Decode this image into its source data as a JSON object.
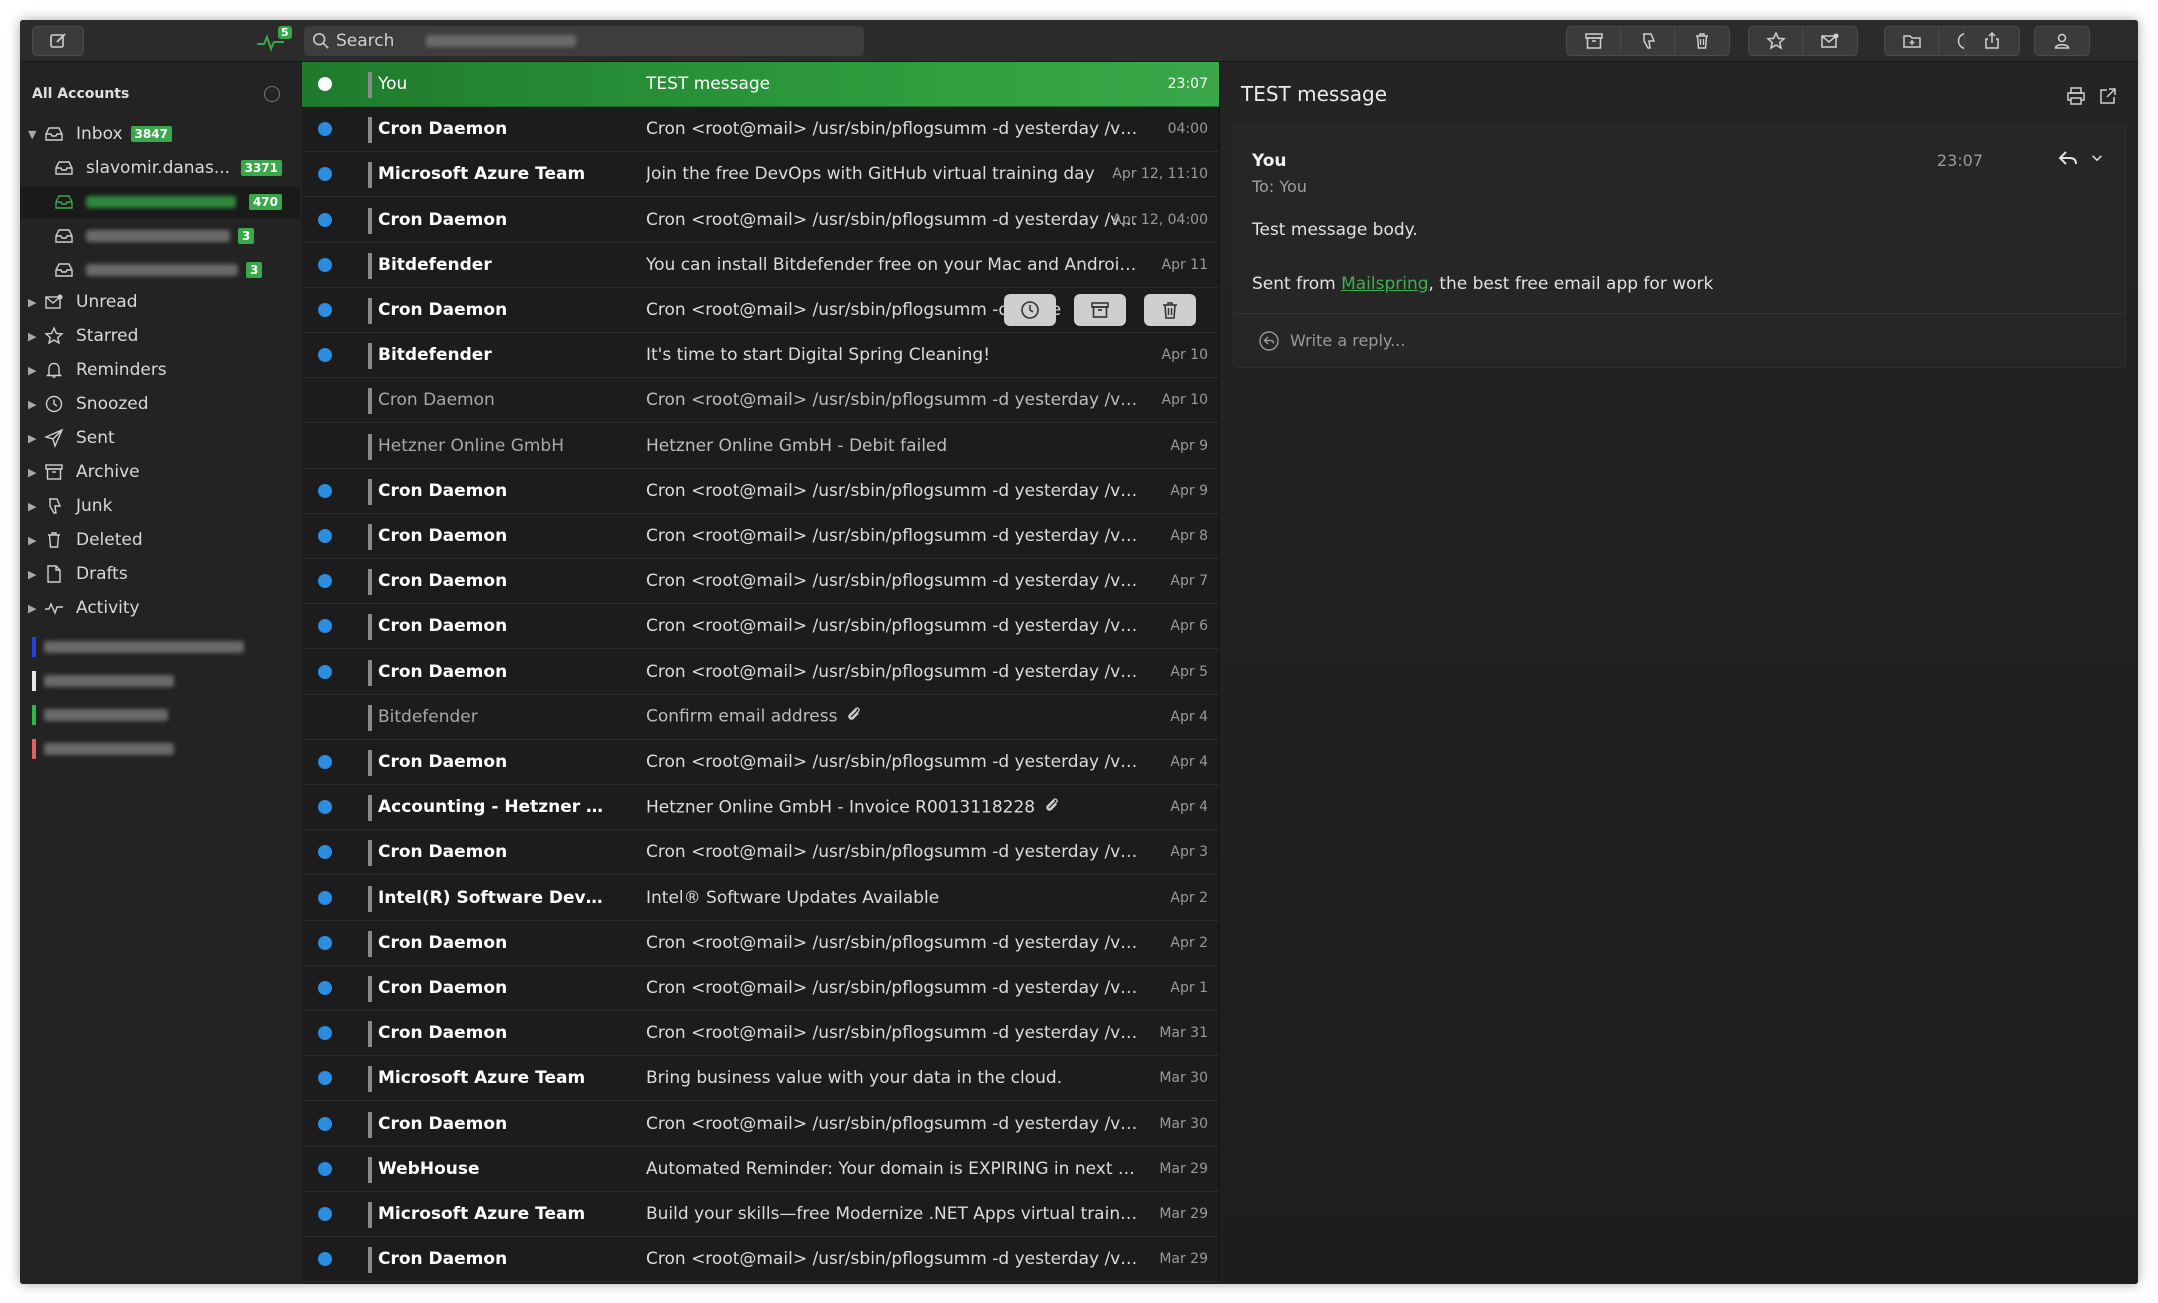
{
  "toolbar": {
    "activity_badge": "5",
    "search_placeholder": "Search",
    "actions": [
      "archive-icon",
      "junk-icon",
      "trash-icon",
      "star-icon",
      "mark-unread-icon",
      "move-folder-icon",
      "snooze-icon",
      "share-icon",
      "account-icon"
    ]
  },
  "sidebar": {
    "header": "All Accounts",
    "inbox": {
      "label": "Inbox",
      "count": "3847"
    },
    "accounts": [
      {
        "label": "slavomir.danas...",
        "count": "3371",
        "blurred": false
      },
      {
        "label": "",
        "count": "470",
        "blurred": true,
        "selected": true
      },
      {
        "label": "",
        "count": "3",
        "blurred": true
      },
      {
        "label": "",
        "count": "3",
        "blurred": true
      }
    ],
    "folders": [
      {
        "label": "Unread",
        "icon": "unread-icon"
      },
      {
        "label": "Starred",
        "icon": "star-icon"
      },
      {
        "label": "Reminders",
        "icon": "bell-icon"
      },
      {
        "label": "Snoozed",
        "icon": "clock-icon"
      },
      {
        "label": "Sent",
        "icon": "send-icon"
      },
      {
        "label": "Archive",
        "icon": "archive-icon"
      },
      {
        "label": "Junk",
        "icon": "junk-icon"
      },
      {
        "label": "Deleted",
        "icon": "trash-icon"
      },
      {
        "label": "Drafts",
        "icon": "draft-icon"
      },
      {
        "label": "Activity",
        "icon": "activity-icon"
      }
    ],
    "label_colors": [
      "#2b3de0",
      "#e8e8e8",
      "#2fb84a",
      "#e06060"
    ]
  },
  "colors": {
    "accent": "#3aa84a",
    "unread_dot": "#2b8de0",
    "link": "#3fb04f"
  },
  "messages": [
    {
      "from": "You",
      "subject": "TEST message",
      "date": "23:07",
      "unread": false,
      "selected": true,
      "clip": false
    },
    {
      "from": "Cron Daemon",
      "subject": "Cron <root@mail> /usr/sbin/pflogsumm -d yesterday /var/log...",
      "date": "04:00",
      "unread": true,
      "clip": false
    },
    {
      "from": "Microsoft Azure Team",
      "subject": "Join the free DevOps with GitHub virtual training day",
      "date": "Apr 12, 11:10",
      "unread": true,
      "clip": false
    },
    {
      "from": "Cron Daemon",
      "subject": "Cron <root@mail> /usr/sbin/pflogsumm -d yesterday /var/lo...",
      "date": "Apr 12, 04:00",
      "unread": true,
      "clip": false
    },
    {
      "from": "Bitdefender",
      "subject": "You can install Bitdefender free on your Mac and Android devi...",
      "date": "Apr 11",
      "unread": true,
      "clip": false
    },
    {
      "from": "Cron Daemon",
      "subject": "Cron <root@mail> /usr/sbin/pflogsumm -d yeste",
      "date": "",
      "unread": true,
      "clip": false,
      "hover": true
    },
    {
      "from": "Bitdefender",
      "subject": "It's time to start Digital Spring Cleaning!",
      "date": "Apr 10",
      "unread": true,
      "clip": false
    },
    {
      "from": "Cron Daemon",
      "subject": "Cron <root@mail> /usr/sbin/pflogsumm -d yesterday /var/log...",
      "date": "Apr 10",
      "unread": false,
      "clip": false
    },
    {
      "from": "Hetzner Online GmbH",
      "subject": "Hetzner Online GmbH - Debit failed",
      "date": "Apr 9",
      "unread": false,
      "clip": false
    },
    {
      "from": "Cron Daemon",
      "subject": "Cron <root@mail> /usr/sbin/pflogsumm -d yesterday /var/log...",
      "date": "Apr 9",
      "unread": true,
      "clip": false
    },
    {
      "from": "Cron Daemon",
      "subject": "Cron <root@mail> /usr/sbin/pflogsumm -d yesterday /var/log...",
      "date": "Apr 8",
      "unread": true,
      "clip": false
    },
    {
      "from": "Cron Daemon",
      "subject": "Cron <root@mail> /usr/sbin/pflogsumm -d yesterday /var/log...",
      "date": "Apr 7",
      "unread": true,
      "clip": false
    },
    {
      "from": "Cron Daemon",
      "subject": "Cron <root@mail> /usr/sbin/pflogsumm -d yesterday /var/log...",
      "date": "Apr 6",
      "unread": true,
      "clip": false
    },
    {
      "from": "Cron Daemon",
      "subject": "Cron <root@mail> /usr/sbin/pflogsumm -d yesterday /var/log...",
      "date": "Apr 5",
      "unread": true,
      "clip": false
    },
    {
      "from": "Bitdefender",
      "subject": "Confirm email address",
      "date": "Apr 4",
      "unread": false,
      "clip": true
    },
    {
      "from": "Cron Daemon",
      "subject": "Cron <root@mail> /usr/sbin/pflogsumm -d yesterday /var/log...",
      "date": "Apr 4",
      "unread": true,
      "clip": false
    },
    {
      "from": "Accounting - Hetzner Onli...",
      "subject": "Hetzner Online GmbH - Invoice R0013118228",
      "date": "Apr 4",
      "unread": true,
      "clip": true
    },
    {
      "from": "Cron Daemon",
      "subject": "Cron <root@mail> /usr/sbin/pflogsumm -d yesterday /var/log...",
      "date": "Apr 3",
      "unread": true,
      "clip": false
    },
    {
      "from": "Intel(R) Software Develop...",
      "subject": "Intel® Software Updates Available",
      "date": "Apr 2",
      "unread": true,
      "clip": false
    },
    {
      "from": "Cron Daemon",
      "subject": "Cron <root@mail> /usr/sbin/pflogsumm -d yesterday /var/log...",
      "date": "Apr 2",
      "unread": true,
      "clip": false
    },
    {
      "from": "Cron Daemon",
      "subject": "Cron <root@mail> /usr/sbin/pflogsumm -d yesterday /var/log...",
      "date": "Apr 1",
      "unread": true,
      "clip": false
    },
    {
      "from": "Cron Daemon",
      "subject": "Cron <root@mail> /usr/sbin/pflogsumm -d yesterday /var/log...",
      "date": "Mar 31",
      "unread": true,
      "clip": false
    },
    {
      "from": "Microsoft Azure Team",
      "subject": "Bring business value with your data in the cloud.",
      "date": "Mar 30",
      "unread": true,
      "clip": false
    },
    {
      "from": "Cron Daemon",
      "subject": "Cron <root@mail> /usr/sbin/pflogsumm -d yesterday /var/log...",
      "date": "Mar 30",
      "unread": true,
      "clip": false
    },
    {
      "from": "WebHouse",
      "subject": "Automated Reminder: Your domain is EXPIRING in next 7 days",
      "date": "Mar 29",
      "unread": true,
      "clip": false
    },
    {
      "from": "Microsoft Azure Team",
      "subject": "Build your skills—free Modernize .NET Apps virtual training day",
      "date": "Mar 29",
      "unread": true,
      "clip": false
    },
    {
      "from": "Cron Daemon",
      "subject": "Cron <root@mail> /usr/sbin/pflogsumm -d yesterday /var/log...",
      "date": "Mar 29",
      "unread": true,
      "clip": false
    }
  ],
  "reader": {
    "title": "TEST message",
    "from": "You",
    "to": "To: You",
    "time": "23:07",
    "body_line1": "Test message body.",
    "body_prefix": "Sent from ",
    "body_link": "Mailspring",
    "body_suffix": ", the best free email app for work",
    "reply_placeholder": "Write a reply..."
  }
}
